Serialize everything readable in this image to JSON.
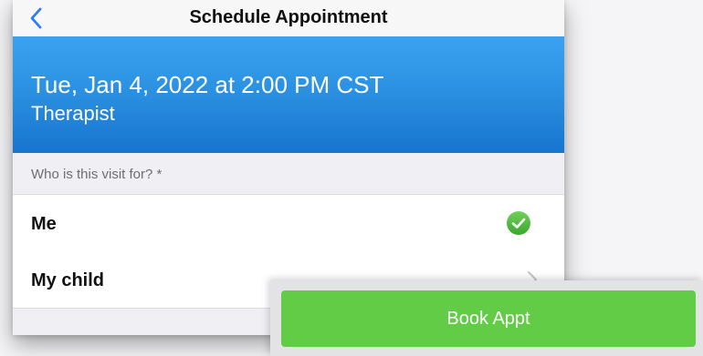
{
  "navbar": {
    "title": "Schedule Appointment",
    "back_icon": "chevron-left-icon"
  },
  "appointment": {
    "datetime": "Tue, Jan 4, 2022 at 2:00 PM CST",
    "provider": "Therapist"
  },
  "visit_for": {
    "header": "Who is this visit for? *",
    "options": [
      {
        "label": "Me",
        "selected": true,
        "icon": "checkmark-circle-icon"
      },
      {
        "label": "My child",
        "selected": false,
        "icon": "chevron-right-icon"
      }
    ]
  },
  "actions": {
    "book_label": "Book Appt"
  },
  "colors": {
    "accent_blue": "#2a8fe0",
    "success_green": "#4cbb3c",
    "button_green": "#62cc46"
  }
}
